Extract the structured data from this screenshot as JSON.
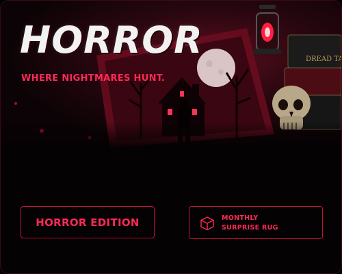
{
  "hero": {
    "title": "HORROR",
    "tagline": "WHERE NIGHTMARES HUNT.",
    "book_spine_text": "DREAD TALES",
    "illustration_description_icon": "haunted-house-rug-illustration"
  },
  "buttons": {
    "edition_label": "HORROR EDITION",
    "monthly_line1": "MONTHLY",
    "monthly_line2": "SURPRISE RUG",
    "monthly_icon": "box-icon"
  },
  "colors": {
    "accent": "#ff2a55",
    "border": "#c3123e",
    "background": "#050203"
  }
}
